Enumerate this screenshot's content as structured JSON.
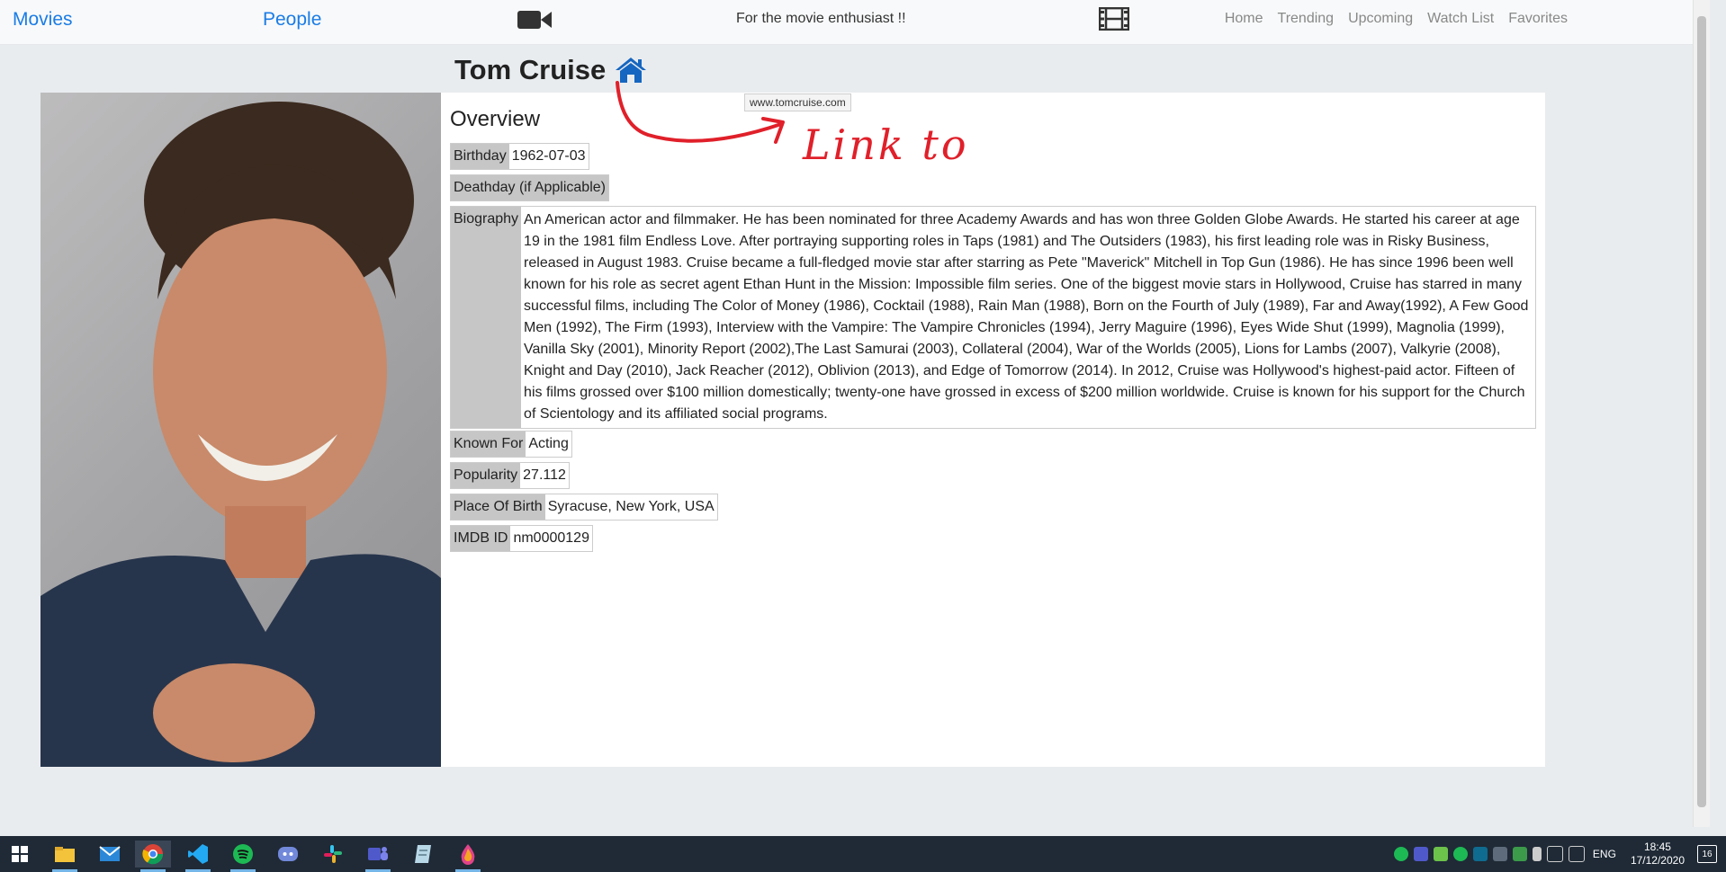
{
  "nav": {
    "movies_label": "Movies",
    "people_label": "People",
    "tagline": "For the movie enthusiast !!",
    "links": [
      "Home",
      "Trending",
      "Upcoming",
      "Watch List",
      "Favorites"
    ]
  },
  "person": {
    "name": "Tom Cruise",
    "homepage_tooltip": "www.tomcruise.com"
  },
  "annotation": {
    "text": "Link to"
  },
  "overview": {
    "heading": "Overview",
    "birthday_label": "Birthday",
    "birthday": "1962-07-03",
    "deathday_label": "Deathday (if Applicable)",
    "biography_label": "Biography",
    "biography": "An American actor and filmmaker. He has been nominated for three Academy Awards and has won three Golden Globe Awards. He started his career at age 19 in the 1981 film Endless Love. After portraying supporting roles in Taps (1981) and The Outsiders (1983), his first leading role was in Risky Business, released in August 1983. Cruise became a full-fledged movie star after starring as Pete \"Maverick\" Mitchell in Top Gun (1986). He has since 1996 been well known for his role as secret agent Ethan Hunt in the Mission: Impossible film series. One of the biggest movie stars in Hollywood, Cruise has starred in many successful films, including The Color of Money (1986), Cocktail (1988), Rain Man (1988), Born on the Fourth of July (1989), Far and Away(1992), A Few Good Men (1992), The Firm (1993), Interview with the Vampire: The Vampire Chronicles (1994), Jerry Maguire (1996), Eyes Wide Shut (1999), Magnolia (1999), Vanilla Sky (2001), Minority Report (2002),The Last Samurai (2003), Collateral (2004), War of the Worlds (2005), Lions for Lambs (2007), Valkyrie (2008), Knight and Day (2010), Jack Reacher (2012), Oblivion (2013), and Edge of Tomorrow (2014). In 2012, Cruise was Hollywood's highest-paid actor. Fifteen of his films grossed over $100 million domestically; twenty-one have grossed in excess of $200 million worldwide. Cruise is known for his support for the Church of Scientology and its affiliated social programs.",
    "known_for_label": "Known For",
    "known_for": "Acting",
    "popularity_label": "Popularity",
    "popularity": "27.112",
    "place_of_birth_label": "Place Of Birth",
    "place_of_birth": "Syracuse, New York, USA",
    "imdb_label": "IMDB ID",
    "imdb_id": "nm0000129"
  },
  "taskbar": {
    "apps": [
      "start-icon",
      "file-explorer-icon",
      "mail-icon",
      "chrome-icon",
      "vscode-icon",
      "spotify-icon",
      "discord-icon",
      "slack-icon",
      "teams-icon",
      "notes-icon",
      "paint-icon"
    ],
    "language": "ENG",
    "time": "18:45",
    "date": "17/12/2020",
    "notification_count": "16"
  },
  "colors": {
    "link": "#1a7ce6",
    "annotation": "#e0202a",
    "label_bg": "#c6c6c6"
  }
}
